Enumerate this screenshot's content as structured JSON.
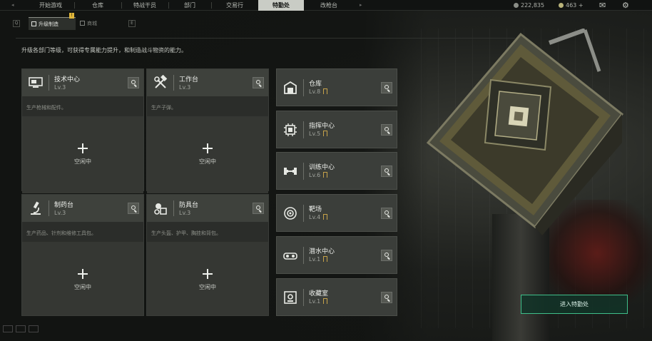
{
  "topnav": {
    "tabs": [
      {
        "label": "开始游戏",
        "active": false
      },
      {
        "label": "仓库",
        "active": false
      },
      {
        "label": "特战干员",
        "active": false
      },
      {
        "label": "部门",
        "active": false
      },
      {
        "label": "交易行",
        "active": false
      },
      {
        "label": "特勤处",
        "active": true
      },
      {
        "label": "改枪台",
        "active": false
      }
    ],
    "currency_1": "222,835",
    "currency_2": "463",
    "currency_2_plus": "+",
    "icons": [
      "mail-icon",
      "settings-gear-icon"
    ]
  },
  "subnav": {
    "tabs": [
      {
        "label": "升级制造",
        "active": true
      },
      {
        "label": "商城",
        "active": false
      }
    ],
    "badge": "!",
    "prev_key": "Q",
    "next_key": "E"
  },
  "description": "升级各部门等级，可获得专属能力提升，和制造战斗物资的能力。",
  "idle_label": "空闲中",
  "production_cards": [
    {
      "name": "技术中心",
      "level": "Lv.3",
      "subtitle": "生产枪械和配件。",
      "icon": "monitor-icon"
    },
    {
      "name": "工作台",
      "level": "Lv.3",
      "subtitle": "生产子弹。",
      "icon": "hammer-wrench-icon"
    },
    {
      "name": "制药台",
      "level": "Lv.3",
      "subtitle": "生产药品、针剂和维修工具包。",
      "icon": "microscope-icon"
    },
    {
      "name": "防具台",
      "level": "Lv.3",
      "subtitle": "生产头盔、护甲、胸挂和背包。",
      "icon": "armor-icon"
    }
  ],
  "facility_cards": [
    {
      "name": "仓库",
      "level": "Lv.8",
      "icon": "warehouse-icon"
    },
    {
      "name": "指挥中心",
      "level": "Lv.5",
      "icon": "chip-icon"
    },
    {
      "name": "训练中心",
      "level": "Lv.6",
      "icon": "dumbbell-icon"
    },
    {
      "name": "靶场",
      "level": "Lv.4",
      "icon": "target-icon"
    },
    {
      "name": "潜水中心",
      "level": "Lv.1",
      "icon": "diving-goggles-icon"
    },
    {
      "name": "收藏室",
      "level": "Lv.1",
      "icon": "safe-icon"
    }
  ],
  "enter_button": "进入特勤处",
  "colors": {
    "accent": "#3fbf8a",
    "active_tab": "#c9ccc5",
    "badge": "#e0b63a"
  }
}
